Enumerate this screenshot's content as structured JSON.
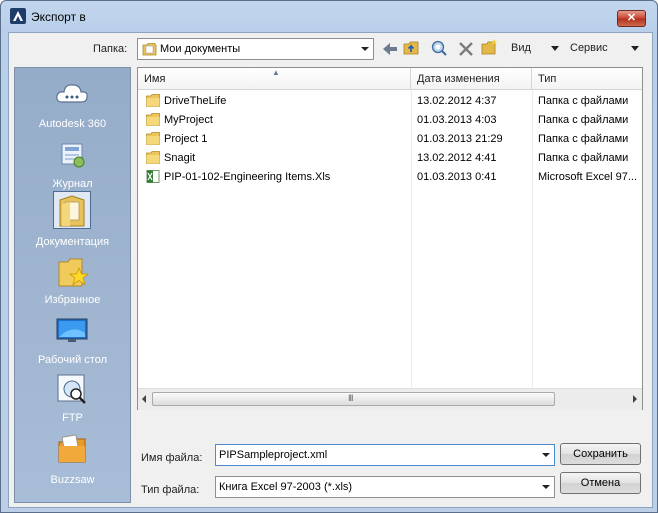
{
  "window": {
    "title": "Экспорт в",
    "close_glyph": "✕"
  },
  "toolbar": {
    "folder_label": "Папка:",
    "folder_value": "Мои документы",
    "view_label": "Вид",
    "tools_label": "Сервис"
  },
  "places": [
    {
      "label": "Autodesk 360",
      "icon": "cloud-icon"
    },
    {
      "label": "Журнал",
      "icon": "history-icon"
    },
    {
      "label": "Документация",
      "icon": "documents-folder-icon",
      "selected": true
    },
    {
      "label": "Избранное",
      "icon": "favorites-icon"
    },
    {
      "label": "Рабочий стол",
      "icon": "desktop-icon"
    },
    {
      "label": "FTP",
      "icon": "ftp-icon"
    },
    {
      "label": "Buzzsaw",
      "icon": "buzzsaw-icon"
    }
  ],
  "columns": {
    "name": "Имя",
    "modified": "Дата изменения",
    "type": "Тип"
  },
  "files": [
    {
      "name": "DriveTheLife",
      "modified": "13.02.2012 4:37",
      "type": "Папка с файлами",
      "kind": "folder"
    },
    {
      "name": "MyProject",
      "modified": "01.03.2013 4:03",
      "type": "Папка с файлами",
      "kind": "folder"
    },
    {
      "name": "Project 1",
      "modified": "01.03.2013 21:29",
      "type": "Папка с файлами",
      "kind": "folder"
    },
    {
      "name": "Snagit",
      "modified": "13.02.2012 4:41",
      "type": "Папка с файлами",
      "kind": "folder"
    },
    {
      "name": "PIP-01-102-Engineering Items.Xls",
      "modified": "01.03.2013 0:41",
      "type": "Microsoft Excel 97...",
      "kind": "excel"
    }
  ],
  "footer": {
    "filename_label": "Имя файла:",
    "filename_value": "PIPSampleproject.xml",
    "filetype_label": "Тип файла:",
    "filetype_value": "Книга Excel 97-2003 (*.xls)",
    "save_label": "Сохранить",
    "cancel_label": "Отмена"
  },
  "scrollbar": {
    "grip": "III"
  }
}
